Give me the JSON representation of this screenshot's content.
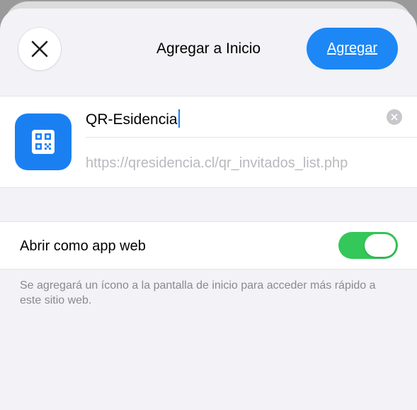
{
  "header": {
    "title": "Agregar a Inicio",
    "add_label": "Agregar",
    "close_icon": "close-icon"
  },
  "bookmark": {
    "name_value": "QR-Esidencia",
    "url_value": "https://qresidencia.cl/qr_invitados_list.php",
    "app_icon": "qr-code-icon",
    "clear_icon": "clear-icon"
  },
  "options": {
    "open_as_web_app_label": "Abrir como app web",
    "open_as_web_app_enabled": true
  },
  "footer": {
    "note": "Se agregará un ícono a la pantalla de inicio para acceder más rápido a este sitio web."
  },
  "colors": {
    "accent": "#1d87f5",
    "toggle_on": "#34c759",
    "sheet_bg": "#f2f2f7"
  }
}
